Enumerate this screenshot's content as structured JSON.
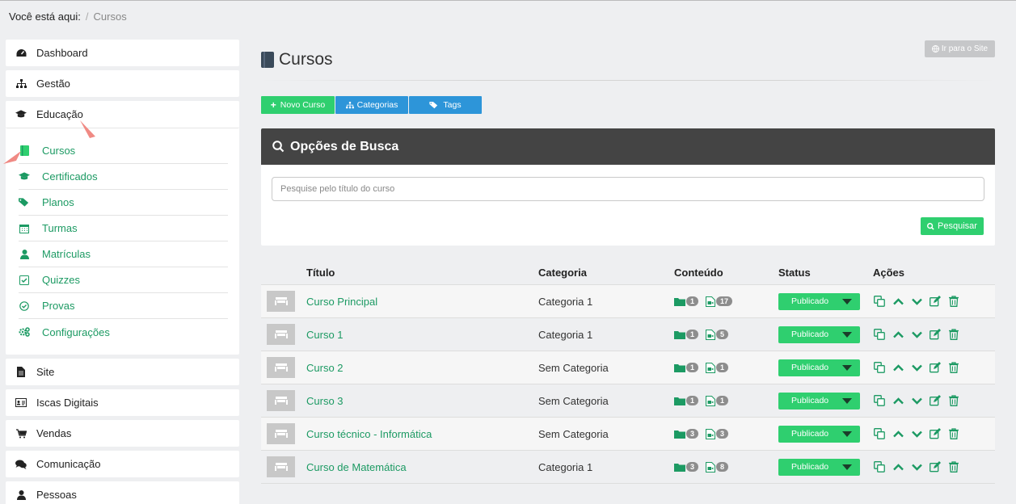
{
  "breadcrumb": {
    "prefix": "Você está aqui:",
    "separator": "/",
    "current": "Cursos"
  },
  "sidebar": {
    "items_top": [
      {
        "label": "Dashboard",
        "icon": "dashboard-icon"
      },
      {
        "label": "Gestão",
        "icon": "sitemap-icon"
      }
    ],
    "education": {
      "label": "Educação",
      "icon": "graduation-cap-icon"
    },
    "submenu": [
      {
        "label": "Cursos",
        "icon": "book-icon"
      },
      {
        "label": "Certificados",
        "icon": "graduation-cap-icon"
      },
      {
        "label": "Planos",
        "icon": "tags-icon"
      },
      {
        "label": "Turmas",
        "icon": "calendar-icon"
      },
      {
        "label": "Matrículas",
        "icon": "user-icon"
      },
      {
        "label": "Quizzes",
        "icon": "check-square-icon"
      },
      {
        "label": "Provas",
        "icon": "check-circle-icon"
      },
      {
        "label": "Configurações",
        "icon": "cogs-icon"
      }
    ],
    "items_bottom": [
      {
        "label": "Site",
        "icon": "file-icon"
      },
      {
        "label": "Iscas Digitais",
        "icon": "id-card-icon"
      },
      {
        "label": "Vendas",
        "icon": "cart-icon"
      },
      {
        "label": "Comunicação",
        "icon": "comments-icon"
      },
      {
        "label": "Pessoas",
        "icon": "user-icon"
      }
    ]
  },
  "header": {
    "title": "Cursos",
    "site_button": "Ir para o Site"
  },
  "toolbar": {
    "new_course": "Novo Curso",
    "categories": "Categorias",
    "tags": "Tags"
  },
  "search": {
    "title": "Opções de Busca",
    "placeholder": "Pesquise pelo título do curso",
    "button": "Pesquisar"
  },
  "table": {
    "headers": {
      "title": "Título",
      "category": "Categoria",
      "content": "Conteúdo",
      "status": "Status",
      "actions": "Ações"
    },
    "rows": [
      {
        "title": "Curso Principal",
        "category": "Categoria 1",
        "folders": "1",
        "files": "17",
        "status": "Publicado"
      },
      {
        "title": "Curso 1",
        "category": "Categoria 1",
        "folders": "1",
        "files": "5",
        "status": "Publicado"
      },
      {
        "title": "Curso 2",
        "category": "Sem Categoria",
        "folders": "1",
        "files": "1",
        "status": "Publicado"
      },
      {
        "title": "Curso 3",
        "category": "Sem Categoria",
        "folders": "1",
        "files": "1",
        "status": "Publicado"
      },
      {
        "title": "Curso técnico - Informática",
        "category": "Sem Categoria",
        "folders": "3",
        "files": "3",
        "status": "Publicado"
      },
      {
        "title": "Curso de Matemática",
        "category": "Categoria 1",
        "folders": "3",
        "files": "8",
        "status": "Publicado"
      }
    ]
  },
  "colors": {
    "accent_green": "#2fcf6f",
    "link_green": "#1c9a63",
    "blue": "#2d95d9",
    "dark_header": "#444444",
    "annotation_arrow": "#f08a84"
  }
}
